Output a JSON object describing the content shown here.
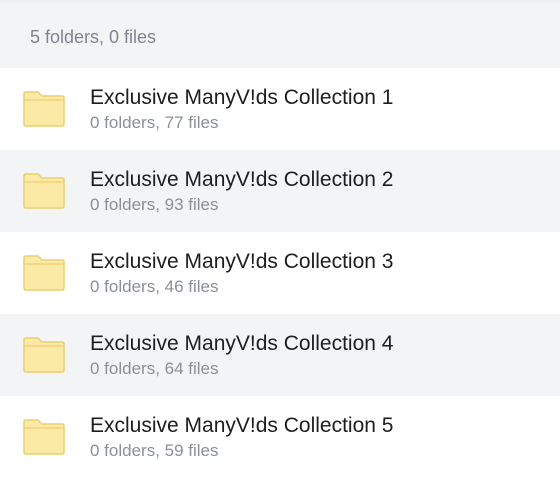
{
  "summary": "5 folders, 0 files",
  "folders": [
    {
      "title": "Exclusive ManyV!ds Collection 1",
      "meta": "0 folders, 77 files"
    },
    {
      "title": "Exclusive ManyV!ds Collection 2",
      "meta": "0 folders, 93 files"
    },
    {
      "title": "Exclusive ManyV!ds Collection 3",
      "meta": "0 folders, 46 files"
    },
    {
      "title": "Exclusive ManyV!ds Collection 4",
      "meta": "0 folders, 64 files"
    },
    {
      "title": "Exclusive ManyV!ds Collection 5",
      "meta": "0 folders, 59 files"
    }
  ],
  "icons": {
    "folder": "folder-icon"
  },
  "colors": {
    "folder_fill": "#fbe9a6",
    "folder_stroke": "#eccf6f"
  }
}
